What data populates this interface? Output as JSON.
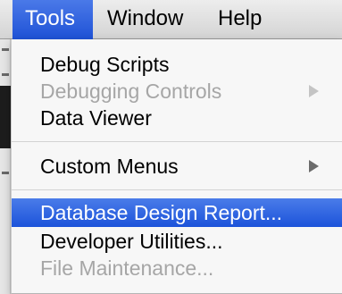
{
  "menubar": {
    "items": [
      {
        "label": "Tools",
        "active": true
      },
      {
        "label": "Window",
        "active": false
      },
      {
        "label": "Help",
        "active": false
      }
    ]
  },
  "tools_menu": {
    "items": [
      {
        "label": "Debug Scripts",
        "enabled": true,
        "submenu": false
      },
      {
        "label": "Debugging Controls",
        "enabled": false,
        "submenu": true
      },
      {
        "label": "Data Viewer",
        "enabled": true,
        "submenu": false
      },
      {
        "label": "Custom Menus",
        "enabled": true,
        "submenu": true
      },
      {
        "label": "Database Design Report...",
        "enabled": true,
        "submenu": false,
        "highlighted": true
      },
      {
        "label": "Developer Utilities...",
        "enabled": true,
        "submenu": false
      },
      {
        "label": "File Maintenance...",
        "enabled": false,
        "submenu": false
      }
    ]
  },
  "icons": {
    "submenu_arrow": "triangle-right-icon"
  },
  "colors": {
    "highlight": "#1c53da",
    "disabled_text": "#a6a6a6",
    "menu_background": "#f7f7f7"
  }
}
